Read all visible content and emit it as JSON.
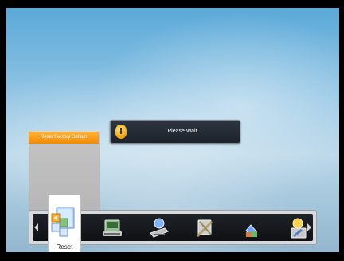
{
  "side_panel": {
    "tab_label": "Reset Factory Default"
  },
  "dialog": {
    "icon": "warning-icon",
    "message": "Please Wait."
  },
  "menu": {
    "selected": {
      "label": "Reset",
      "icon": "reset-icon"
    },
    "items": [
      {
        "icon": "installation-icon"
      },
      {
        "icon": "network-icon"
      },
      {
        "icon": "tools-icon"
      },
      {
        "icon": "games-icon"
      },
      {
        "icon": "settings-icon"
      }
    ]
  },
  "colors": {
    "tab_orange": "#f28a00",
    "dialog_bg": "#1d232b",
    "sky": "#8fc3e3"
  }
}
